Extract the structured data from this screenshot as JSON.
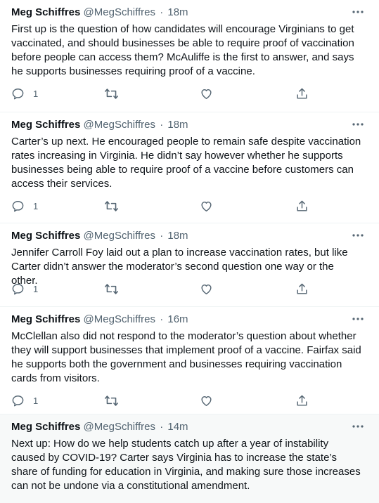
{
  "tweets": [
    {
      "name": "Meg Schiffres",
      "handle": "@MegSchiffres",
      "separator": "·",
      "time": "18m",
      "text": "First up is the question of how candidates will encourage Virginians to get vaccinated, and should businesses be able to require proof of vaccination before people can access them? McAuliffe is the first to answer, and says he supports businesses requiring proof of a vaccine.",
      "reply_count": "1"
    },
    {
      "name": "Meg Schiffres",
      "handle": "@MegSchiffres",
      "separator": "·",
      "time": "18m",
      "text": "Carter’s up next. He encouraged people to remain safe despite vaccination rates increasing in Virginia. He didn’t say however whether he supports businesses being able to require proof of a vaccine before customers can access their services.",
      "reply_count": "1"
    },
    {
      "name": "Meg Schiffres",
      "handle": "@MegSchiffres",
      "separator": "·",
      "time": "18m",
      "text": "Jennifer Carroll Foy laid out a plan to increase vaccination rates, but like Carter didn’t answer the moderator’s second question one way or the other.",
      "reply_count": "1"
    },
    {
      "name": "Meg Schiffres",
      "handle": "@MegSchiffres",
      "separator": "·",
      "time": "16m",
      "text": "McClellan also did not respond to the moderator’s question about whether they will support businesses that implement proof of a vaccine. Fairfax said he supports both the government and businesses requiring vaccination cards from visitors.",
      "reply_count": "1"
    },
    {
      "name": "Meg Schiffres",
      "handle": "@MegSchiffres",
      "separator": "·",
      "time": "14m",
      "text": "Next up: How do we help students catch up after a year of instability caused by COVID-19? Carter says Virginia has to increase the state’s share of funding for education in Virginia, and making sure those increases can not be undone via a constitutional amendment."
    }
  ],
  "icons": {
    "more": "more-icon",
    "reply": "reply-icon",
    "retweet": "retweet-icon",
    "like": "like-icon",
    "share": "share-icon"
  },
  "colors": {
    "text": "#0f1419",
    "secondary": "#536471",
    "divider": "#eff3f4",
    "highlight_bg": "#f7f9f9"
  }
}
